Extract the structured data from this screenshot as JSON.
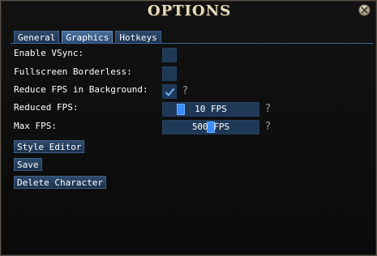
{
  "window": {
    "title": "OPTIONS"
  },
  "tabs": [
    {
      "label": "General",
      "active": false
    },
    {
      "label": "Graphics",
      "active": true
    },
    {
      "label": "Hotkeys",
      "active": false
    }
  ],
  "settings": {
    "vsync": {
      "label": "Enable VSync:",
      "checked": false
    },
    "borderless": {
      "label": "Fullscreen Borderless:",
      "checked": false
    },
    "reduce_fps": {
      "label": "Reduce FPS in Background:",
      "checked": true,
      "help": "?"
    },
    "reduced_fps": {
      "label": "Reduced FPS:",
      "value_text": "10 FPS",
      "help": "?"
    },
    "max_fps": {
      "label": "Max FPS:",
      "value_text": "500 FPS",
      "help": "?"
    }
  },
  "buttons": {
    "style_editor": "Style Editor",
    "save": "Save",
    "delete_character": "Delete Character"
  },
  "colors": {
    "accent": "#3a8cff",
    "panel": "#1f3856",
    "text": "#ffffff"
  },
  "icons": {
    "close": "close-icon",
    "check": "checkmark-icon"
  }
}
